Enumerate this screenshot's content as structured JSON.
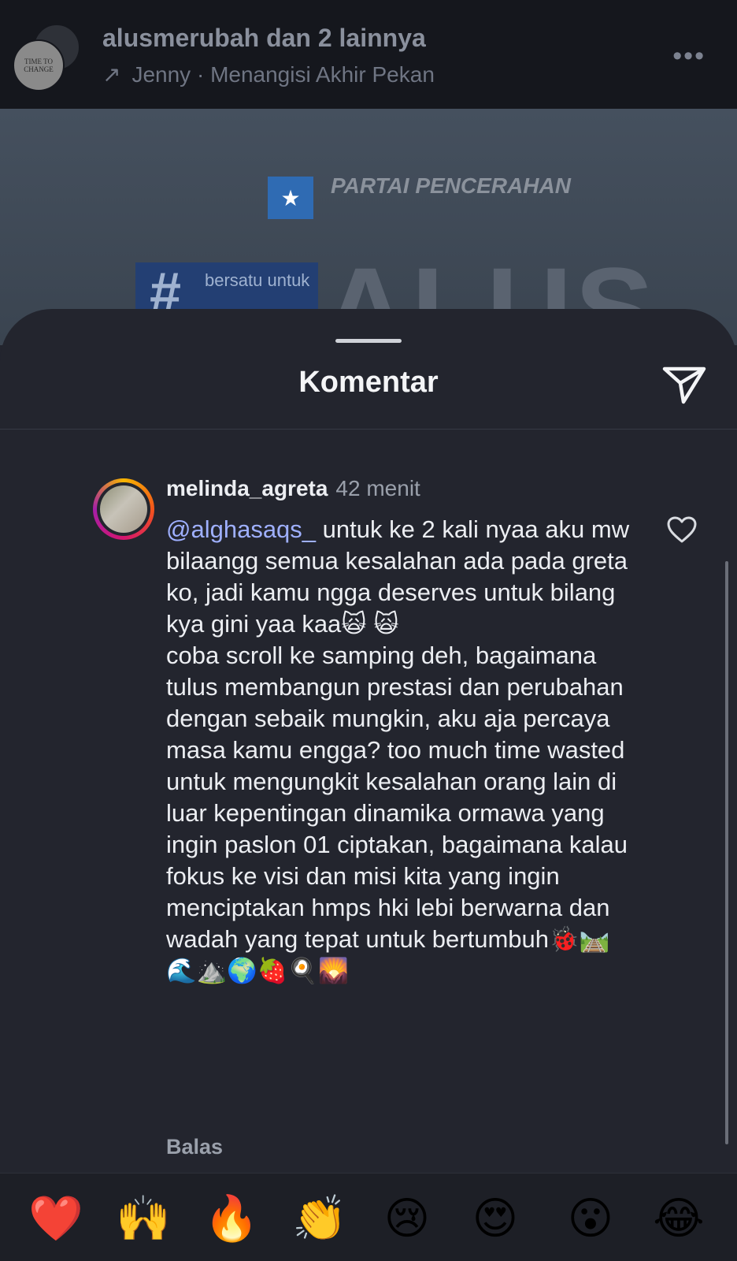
{
  "header": {
    "username": "alusmerubah",
    "others": " dan 2 lainnya",
    "audio_arrow": "↗",
    "audio": "Jenny · Menangisi Akhir Pekan",
    "avatar_text": "TIME TO CHANGE",
    "more_icon": "•••"
  },
  "post_image": {
    "party_name": "PARTAI PENCERAHAN",
    "hash_sign": "#",
    "hash_text": "bersatu untuk",
    "big_text": "ALUS"
  },
  "sheet": {
    "title": "Komentar"
  },
  "comment": {
    "username": "melinda_agreta",
    "time": "42 menit",
    "mention": "@alghasaqs_",
    "paragraph1": " untuk ke 2 kali nyaa aku mw bilaangg semua kesalahan ada pada greta ko, jadi kamu ngga deserves untuk bilang kya gini yaa kaa🙀 🙀",
    "paragraph2": "coba scroll ke samping deh, bagaimana tulus membangun prestasi dan perubahan dengan sebaik mungkin, aku aja percaya masa kamu engga? too much time wasted untuk mengungkit kesalahan orang lain di luar kepentingan dinamika ormawa yang ingin paslon 01 ciptakan, bagaimana kalau fokus ke visi dan misi kita yang ingin menciptakan hmps hki lebi berwarna dan wadah yang tepat untuk bertumbuh🐞🛤️🌊⛰️🌍🍓🍳🌄",
    "reply_label": "Balas"
  },
  "reactions": [
    "❤️",
    "🙌",
    "🔥",
    "👏",
    "😢",
    "😍",
    "😮",
    "😂"
  ]
}
